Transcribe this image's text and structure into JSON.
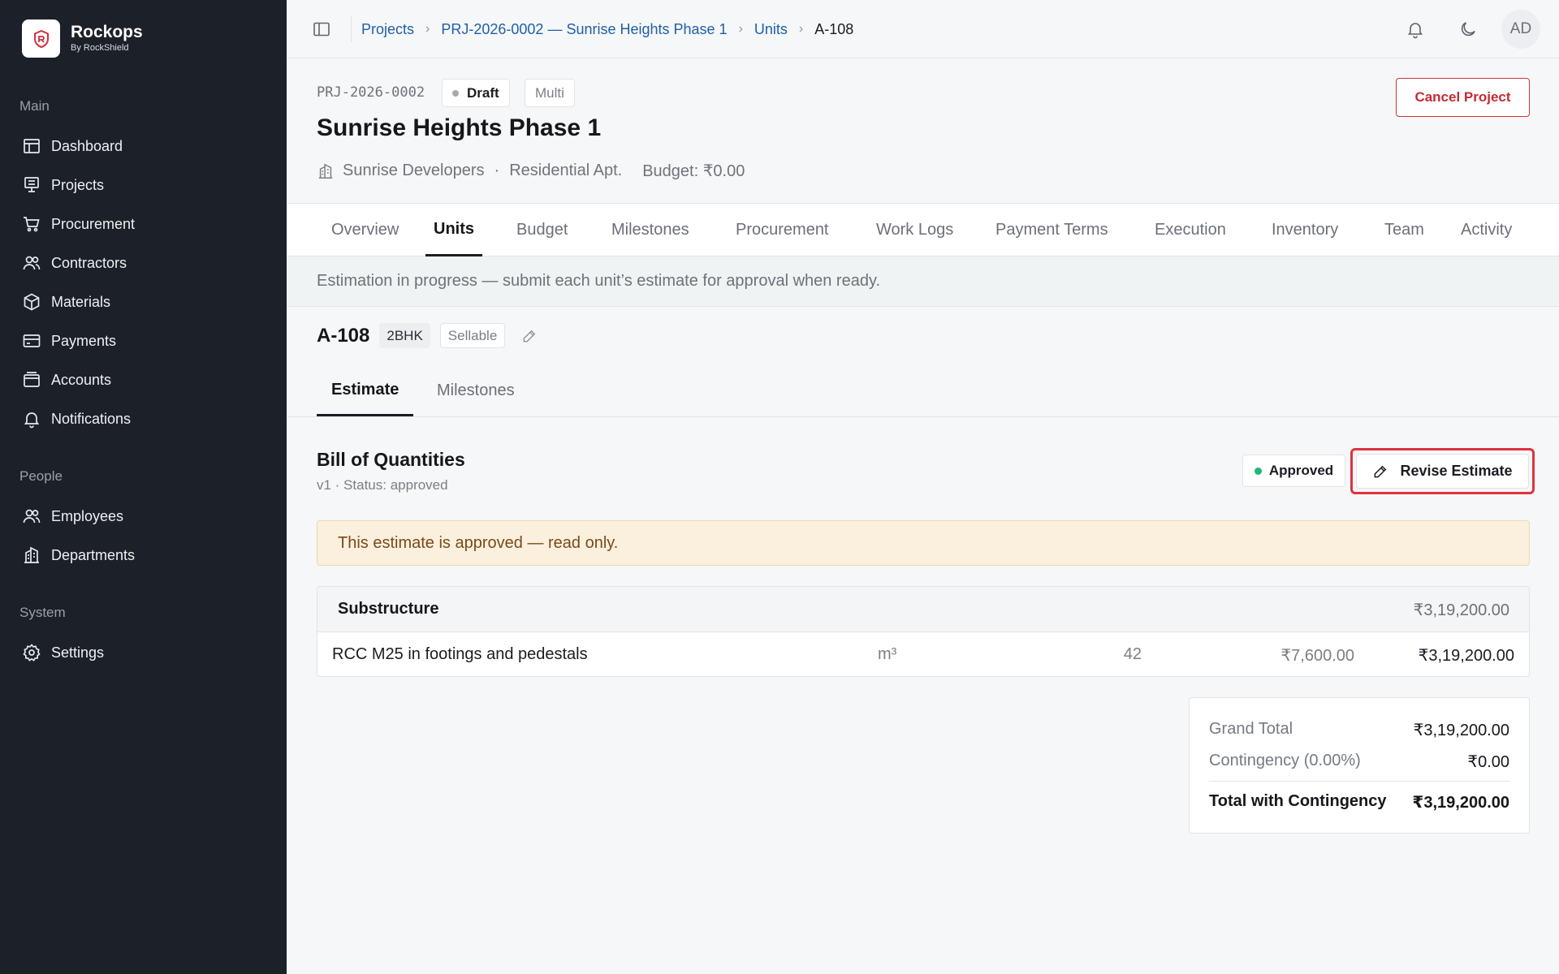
{
  "brand": {
    "name": "Rockops",
    "subtitle": "By RockShield"
  },
  "sidebar": {
    "sections": [
      {
        "label": "Main"
      },
      {
        "label": "People"
      },
      {
        "label": "System"
      }
    ],
    "items": [
      {
        "label": "Dashboard",
        "icon": "dashboard-icon"
      },
      {
        "label": "Projects",
        "icon": "projects-icon"
      },
      {
        "label": "Procurement",
        "icon": "cart-icon"
      },
      {
        "label": "Contractors",
        "icon": "users-icon"
      },
      {
        "label": "Materials",
        "icon": "box-icon"
      },
      {
        "label": "Payments",
        "icon": "card-icon"
      },
      {
        "label": "Accounts",
        "icon": "wallet-icon"
      },
      {
        "label": "Notifications",
        "icon": "bell-icon"
      },
      {
        "label": "Employees",
        "icon": "users-icon"
      },
      {
        "label": "Departments",
        "icon": "building-icon"
      },
      {
        "label": "Settings",
        "icon": "gear-icon"
      }
    ]
  },
  "breadcrumb": {
    "items": [
      "Projects",
      "PRJ-2026-0002 — Sunrise Heights Phase 1",
      "Units"
    ],
    "current": "A-108"
  },
  "user": {
    "initials": "AD"
  },
  "project": {
    "code": "PRJ-2026-0002",
    "status": "Draft",
    "mode": "Multi",
    "title": "Sunrise Heights Phase 1",
    "developer": "Sunrise Developers",
    "separator": "·",
    "type": "Residential Apt.",
    "budget": "Budget: ₹0.00",
    "cancel_label": "Cancel Project"
  },
  "tabs": [
    "Overview",
    "Units",
    "Budget",
    "Milestones",
    "Procurement",
    "Work Logs",
    "Payment Terms",
    "Execution",
    "Inventory",
    "Team",
    "Activity"
  ],
  "active_tab": "Units",
  "info_banner": "Estimation in progress — submit each unit’s estimate for approval when ready.",
  "unit": {
    "name": "A-108",
    "type": "2BHK",
    "tag": "Sellable"
  },
  "subtabs": [
    "Estimate",
    "Milestones"
  ],
  "boq": {
    "title": "Bill of Quantities",
    "subtitle": "v1 · Status: approved",
    "status_badge": "Approved",
    "revise_label": "Revise Estimate",
    "readonly_notice": "This estimate is approved — read only.",
    "section": {
      "name": "Substructure",
      "total": "₹3,19,200.00"
    },
    "items": [
      {
        "description": "RCC M25 in footings and pedestals",
        "unit": "m³",
        "qty": "42",
        "rate": "₹7,600.00",
        "amount": "₹3,19,200.00"
      }
    ]
  },
  "totals": {
    "grand_total_label": "Grand Total",
    "grand_total": "₹3,19,200.00",
    "contingency_label": "Contingency (0.00%)",
    "contingency": "₹0.00",
    "final_label": "Total with Contingency",
    "final": "₹3,19,200.00"
  },
  "colors": {
    "sidebar_bg": "#1c2028",
    "accent_link": "#1f5fa8",
    "danger": "#c42b34",
    "approved": "#1fb877",
    "warning_bg": "#fbf0de"
  }
}
